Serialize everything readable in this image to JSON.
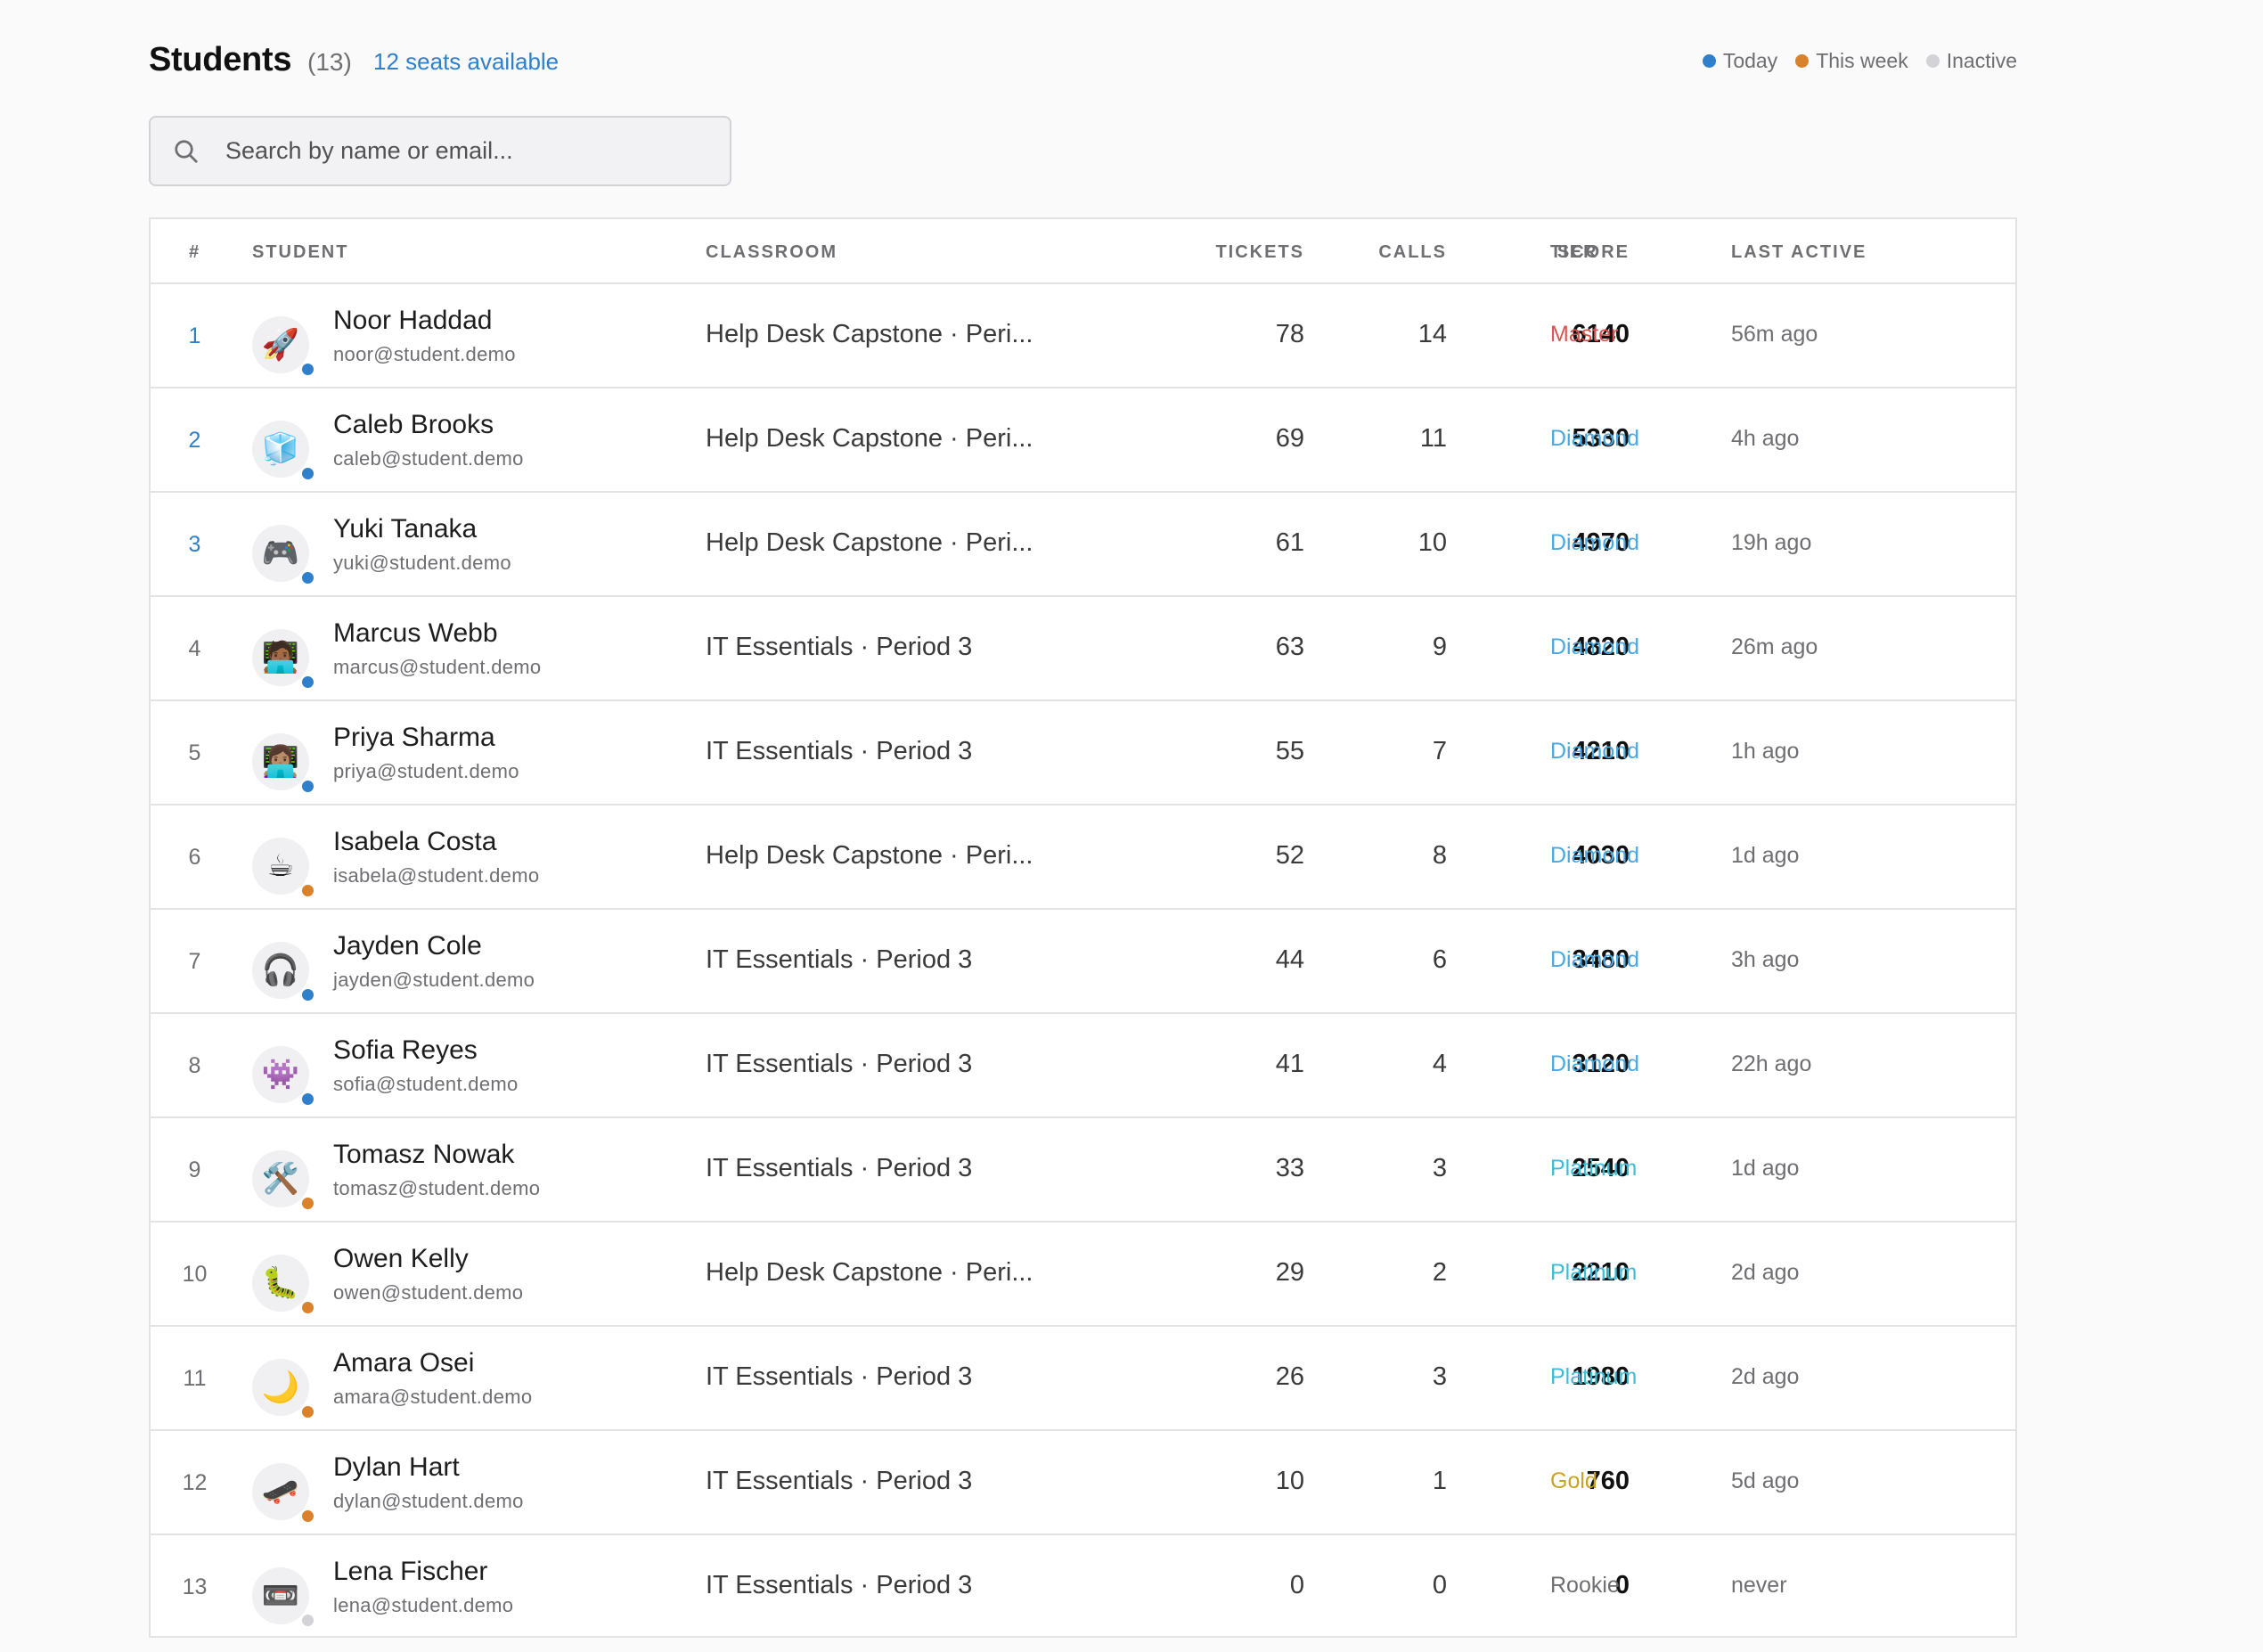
{
  "header": {
    "title": "Students",
    "count": "(13)",
    "seats": "12 seats available"
  },
  "legend": [
    {
      "label": "Today",
      "color": "#2f7fcb"
    },
    {
      "label": "This week",
      "color": "#d9822b"
    },
    {
      "label": "Inactive",
      "color": "#d2d2d7"
    }
  ],
  "search": {
    "placeholder": "Search by name or email..."
  },
  "columns": {
    "rank": "#",
    "student": "STUDENT",
    "classroom": "CLASSROOM",
    "tickets": "TICKETS",
    "calls": "CALLS",
    "score": "SCORE",
    "tier": "TIER",
    "last_active": "LAST ACTIVE"
  },
  "tier_colors": {
    "Master": "#d9534f",
    "Diamond": "#4aa8e0",
    "Platinum": "#3bbcd9",
    "Gold": "#c9a227",
    "Rookie": "#6e6e73"
  },
  "students": [
    {
      "rank": "1",
      "avatar": "🚀",
      "status": "today",
      "name": "Noor Haddad",
      "email": "noor@student.demo",
      "classroom": "Help Desk Capstone · Peri...",
      "tickets": "78",
      "calls": "14",
      "score": "6140",
      "tier": "Master",
      "last_active": "56m ago"
    },
    {
      "rank": "2",
      "avatar": "🧊",
      "status": "today",
      "name": "Caleb Brooks",
      "email": "caleb@student.demo",
      "classroom": "Help Desk Capstone · Peri...",
      "tickets": "69",
      "calls": "11",
      "score": "5330",
      "tier": "Diamond",
      "last_active": "4h ago"
    },
    {
      "rank": "3",
      "avatar": "🎮",
      "status": "today",
      "name": "Yuki Tanaka",
      "email": "yuki@student.demo",
      "classroom": "Help Desk Capstone · Peri...",
      "tickets": "61",
      "calls": "10",
      "score": "4970",
      "tier": "Diamond",
      "last_active": "19h ago"
    },
    {
      "rank": "4",
      "avatar": "🧑🏾‍💻",
      "status": "today",
      "name": "Marcus Webb",
      "email": "marcus@student.demo",
      "classroom": "IT Essentials · Period 3",
      "tickets": "63",
      "calls": "9",
      "score": "4820",
      "tier": "Diamond",
      "last_active": "26m ago"
    },
    {
      "rank": "5",
      "avatar": "👩🏽‍💻",
      "status": "today",
      "name": "Priya Sharma",
      "email": "priya@student.demo",
      "classroom": "IT Essentials · Period 3",
      "tickets": "55",
      "calls": "7",
      "score": "4210",
      "tier": "Diamond",
      "last_active": "1h ago"
    },
    {
      "rank": "6",
      "avatar": "☕",
      "status": "week",
      "name": "Isabela Costa",
      "email": "isabela@student.demo",
      "classroom": "Help Desk Capstone · Peri...",
      "tickets": "52",
      "calls": "8",
      "score": "4030",
      "tier": "Diamond",
      "last_active": "1d ago"
    },
    {
      "rank": "7",
      "avatar": "🎧",
      "status": "today",
      "name": "Jayden Cole",
      "email": "jayden@student.demo",
      "classroom": "IT Essentials · Period 3",
      "tickets": "44",
      "calls": "6",
      "score": "3480",
      "tier": "Diamond",
      "last_active": "3h ago"
    },
    {
      "rank": "8",
      "avatar": "👾",
      "status": "today",
      "name": "Sofia Reyes",
      "email": "sofia@student.demo",
      "classroom": "IT Essentials · Period 3",
      "tickets": "41",
      "calls": "4",
      "score": "3120",
      "tier": "Diamond",
      "last_active": "22h ago"
    },
    {
      "rank": "9",
      "avatar": "🛠️",
      "status": "week",
      "name": "Tomasz Nowak",
      "email": "tomasz@student.demo",
      "classroom": "IT Essentials · Period 3",
      "tickets": "33",
      "calls": "3",
      "score": "2540",
      "tier": "Platinum",
      "last_active": "1d ago"
    },
    {
      "rank": "10",
      "avatar": "🐛",
      "status": "week",
      "name": "Owen Kelly",
      "email": "owen@student.demo",
      "classroom": "Help Desk Capstone · Peri...",
      "tickets": "29",
      "calls": "2",
      "score": "2210",
      "tier": "Platinum",
      "last_active": "2d ago"
    },
    {
      "rank": "11",
      "avatar": "🌙",
      "status": "week",
      "name": "Amara Osei",
      "email": "amara@student.demo",
      "classroom": "IT Essentials · Period 3",
      "tickets": "26",
      "calls": "3",
      "score": "1980",
      "tier": "Platinum",
      "last_active": "2d ago"
    },
    {
      "rank": "12",
      "avatar": "🛹",
      "status": "week",
      "name": "Dylan Hart",
      "email": "dylan@student.demo",
      "classroom": "IT Essentials · Period 3",
      "tickets": "10",
      "calls": "1",
      "score": "760",
      "tier": "Gold",
      "last_active": "5d ago"
    },
    {
      "rank": "13",
      "avatar": "📼",
      "status": "inactive",
      "name": "Lena Fischer",
      "email": "lena@student.demo",
      "classroom": "IT Essentials · Period 3",
      "tickets": "0",
      "calls": "0",
      "score": "0",
      "tier": "Rookie",
      "last_active": "never"
    }
  ]
}
